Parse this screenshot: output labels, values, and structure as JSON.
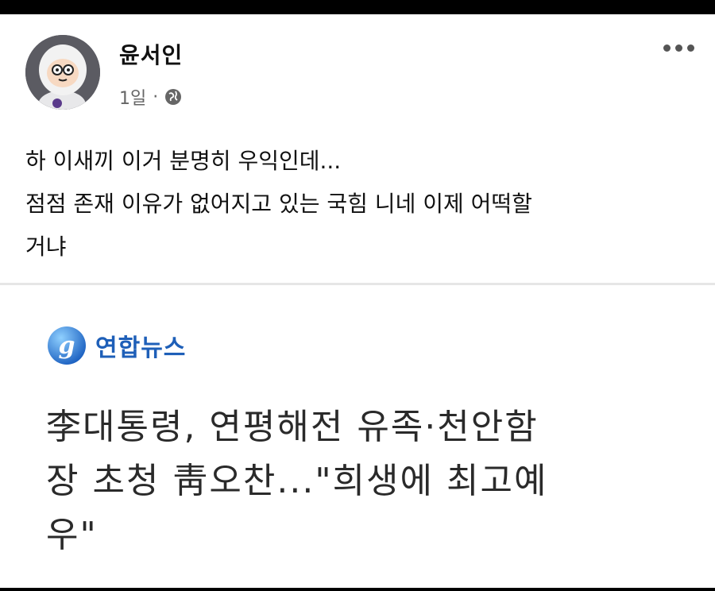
{
  "post": {
    "author": "윤서인",
    "time": "1일",
    "separator": "·",
    "audience_icon": "globe-icon",
    "more_icon": "more-options-icon",
    "text_lines": [
      "하 이새끼 이거 분명히 우익인데...",
      "점점 존재 이유가 없어지고 있는 국힘 니네 이제 어떡할",
      "거냐"
    ]
  },
  "link_preview": {
    "source_name": "연합뉴스",
    "source_logo_icon": "yonhap-logo-icon",
    "headline_lines": [
      "李대통령, 연평해전 유족·천안함",
      "장 초청 靑오찬...\"희생에 최고예",
      "우\""
    ]
  },
  "colors": {
    "background": "#ffffff",
    "text": "#111111",
    "meta": "#666666",
    "source_blue": "#1e5fb8",
    "headline": "#2a2a2a"
  }
}
